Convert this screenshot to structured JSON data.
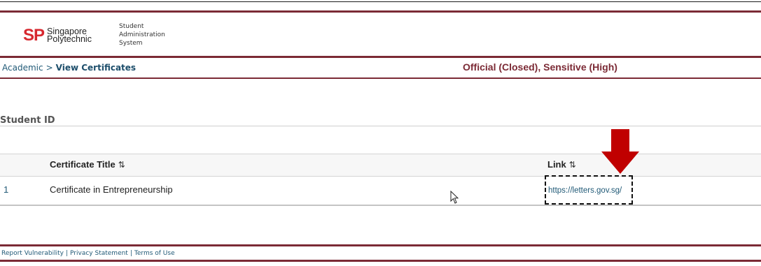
{
  "header": {
    "logo_mark": "SP",
    "logo_line1": "Singapore",
    "logo_line2": "Polytechnic",
    "system_line1": "Student",
    "system_line2": "Administration",
    "system_line3": "System"
  },
  "breadcrumb": {
    "parent": "Academic",
    "separator": ">",
    "current": "View Certificates"
  },
  "classification": "Official (Closed), Sensitive (High)",
  "student": {
    "label": "Student ID"
  },
  "table": {
    "columns": [
      {
        "label": "Certificate Title",
        "sort_icon": "⇅"
      },
      {
        "label": "Link",
        "sort_icon": "⇅"
      }
    ],
    "rows": [
      {
        "index": "1",
        "title": "Certificate in Entrepreneurship",
        "link": "https://letters.gov.sg/"
      }
    ]
  },
  "footer": {
    "links": [
      "Report Vulnerability",
      "Privacy Statement",
      "Terms of Use"
    ],
    "separator": "|"
  },
  "colors": {
    "brand_red": "#d7282f",
    "maroon": "#7b2a35",
    "link_blue": "#215a77",
    "annotation_red": "#c00000"
  },
  "icons": {
    "sort": "sort-arrows-icon",
    "annotation": "red-down-arrow-icon",
    "pointer": "mouse-cursor-icon"
  }
}
